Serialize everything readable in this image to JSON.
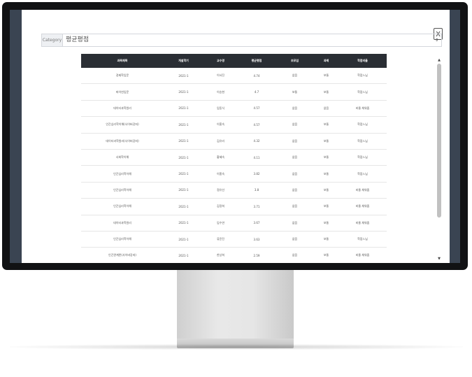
{
  "modal": {
    "close_label": "X",
    "category": {
      "label": "Category",
      "selected": "평균평점",
      "arrow": "⇕"
    }
  },
  "table": {
    "headers": [
      "과목제목",
      "개설학기",
      "교수명",
      "평균평점",
      "조모임",
      "과제",
      "학점비율"
    ],
    "rows": [
      [
        "경제학입문",
        "2021-1",
        "이서진",
        "4.74",
        "없음",
        "보통",
        "학점느님"
      ],
      [
        "파이썬입문",
        "2021-1",
        "이승현",
        "4.7",
        "보통",
        "보통",
        "학점느님"
      ],
      [
        "데이터과학원리",
        "2021-1",
        "임동식",
        "4.57",
        "없음",
        "없음",
        "비율 채워줌"
      ],
      [
        "인간심리학이해(사이버강좌)",
        "2021-1",
        "이홍숙",
        "4.57",
        "없음",
        "보통",
        "학점느님"
      ],
      [
        "데이터과학원리(사이버강좌)",
        "2021-1",
        "김유리",
        "4.32",
        "없음",
        "보통",
        "학점느님"
      ],
      [
        "사회학이해",
        "2021-1",
        "황혜숙",
        "4.11",
        "없음",
        "보통",
        "학점느님"
      ],
      [
        "인간심리학이해",
        "2021-1",
        "이홍숙",
        "3.82",
        "없음",
        "보통",
        "학점느님"
      ],
      [
        "인간심리학이해",
        "2021-1",
        "정유선",
        "3.8",
        "없음",
        "보통",
        "비율 채워줌"
      ],
      [
        "인간심리학이해",
        "2021-1",
        "김정희",
        "3.71",
        "없음",
        "보통",
        "비율 채워줌"
      ],
      [
        "데이터과학원리",
        "2021-1",
        "임수연",
        "3.67",
        "없음",
        "보통",
        "비율 채워줌"
      ],
      [
        "인간심리학이해",
        "2021-1",
        "류윤진",
        "3.63",
        "없음",
        "보통",
        "학점느님"
      ],
      [
        "인간관계론(사이버강좌)",
        "2021-1",
        "한상희",
        "2.59",
        "없음",
        "보통",
        "비율 채워줌"
      ]
    ]
  },
  "scrollbar": {
    "up": "▲",
    "down": "▼"
  }
}
